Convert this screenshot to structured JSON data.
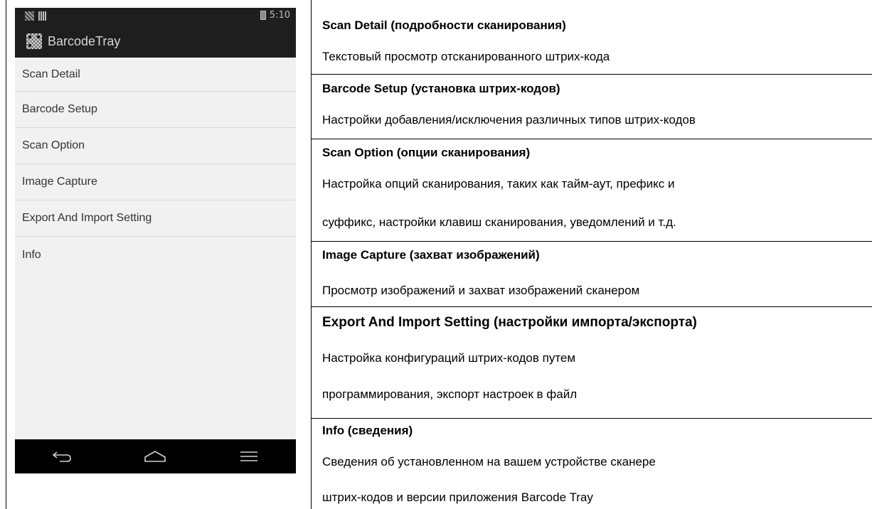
{
  "phone": {
    "status_time": "5:10",
    "app_title": "BarcodeTray",
    "menu_items": [
      {
        "label": "Scan Detail"
      },
      {
        "label": "Barcode Setup"
      },
      {
        "label": "Scan Option"
      },
      {
        "label": "Image Capture"
      },
      {
        "label": "Export And Import Setting"
      },
      {
        "label": "Info"
      }
    ],
    "nav_icons": [
      "back-icon",
      "home-icon",
      "menu-icon"
    ]
  },
  "table": {
    "sections": [
      {
        "heading": "Scan Detail (подробности сканирования)",
        "lines": [
          "Текстовый просмотр отсканированного штрих-кода"
        ]
      },
      {
        "heading": "Barcode Setup (установка штрих-кодов)",
        "lines": [
          "Настройки добавления/исключения различных типов штрих-кодов"
        ]
      },
      {
        "heading": "Scan Option (опции сканирования)",
        "lines": [
          "Настройка опций сканирования, таких как тайм-аут, префикс и",
          "суффикс, настройки клавиш сканирования, уведомлений и т.д."
        ]
      },
      {
        "heading": "Image Capture (захват изображений)",
        "lines": [
          "Просмотр изображений и захват изображений сканером"
        ]
      },
      {
        "heading": "Export And Import Setting (настройки импорта/экспорта)",
        "lines": [
          "Настройка конфигураций штрих-кодов путем",
          "программирования, экспорт настроек в файл"
        ]
      },
      {
        "heading": "Info (сведения)",
        "lines": [
          "Сведения об установленном на вашем устройстве сканере",
          "штрих-кодов и версии приложения Barcode Tray"
        ]
      }
    ]
  }
}
